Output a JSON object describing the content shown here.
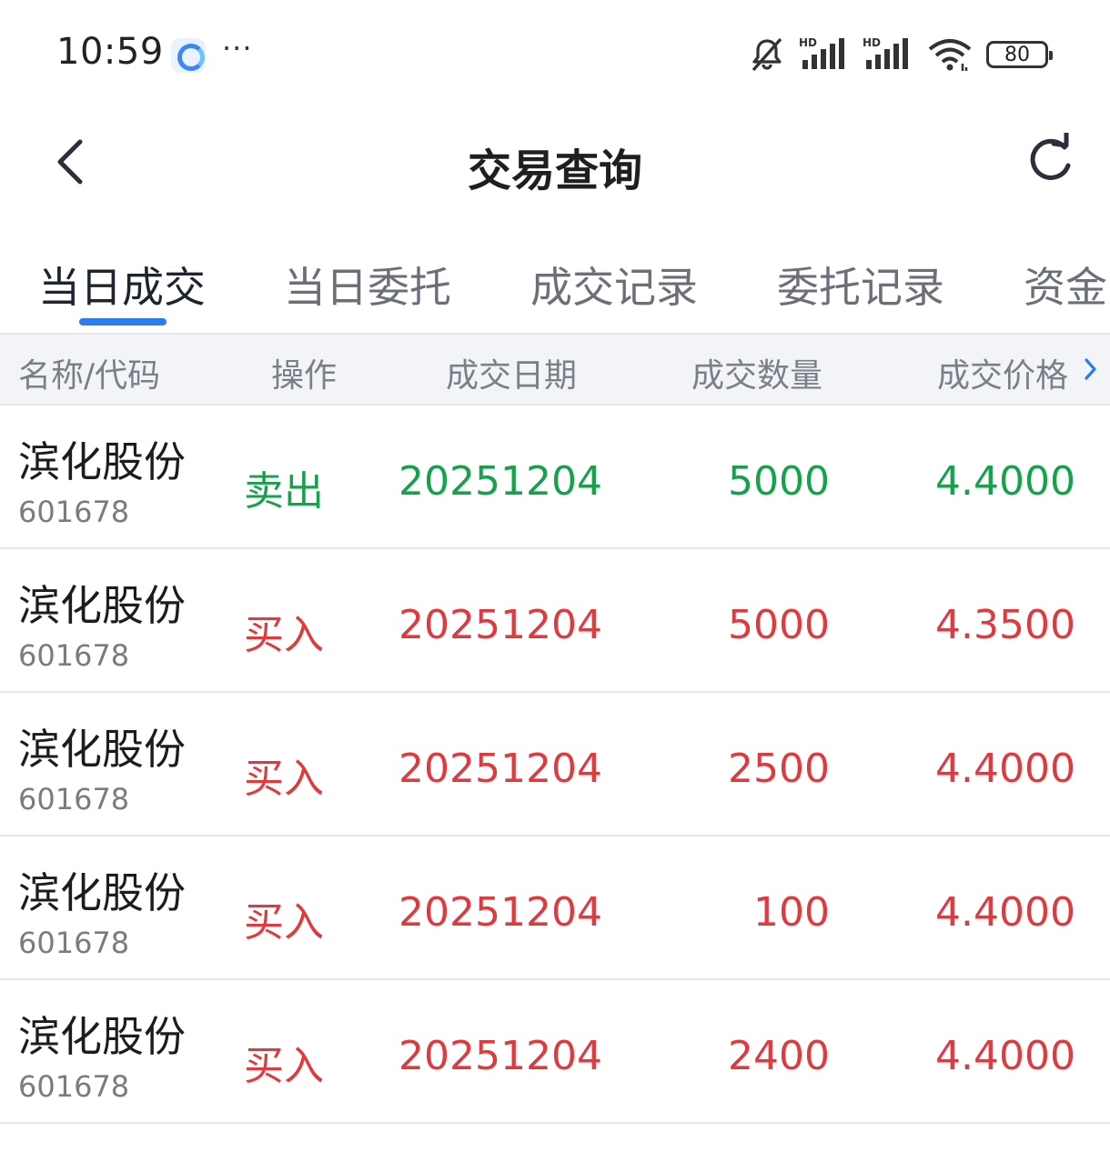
{
  "status_bar": {
    "time": "10:59",
    "more": "···",
    "battery": "80"
  },
  "header": {
    "title": "交易查询"
  },
  "tabs": [
    {
      "label": "当日成交"
    },
    {
      "label": "当日委托"
    },
    {
      "label": "成交记录"
    },
    {
      "label": "委托记录"
    },
    {
      "label": "资金"
    }
  ],
  "table": {
    "columns": [
      "名称/代码",
      "操作",
      "成交日期",
      "成交数量",
      "成交价格"
    ],
    "rows": [
      {
        "name": "滨化股份",
        "code": "601678",
        "op": "卖出",
        "date": "20251204",
        "qty": "5000",
        "price": "4.4000",
        "side": "sell"
      },
      {
        "name": "滨化股份",
        "code": "601678",
        "op": "买入",
        "date": "20251204",
        "qty": "5000",
        "price": "4.3500",
        "side": "buy"
      },
      {
        "name": "滨化股份",
        "code": "601678",
        "op": "买入",
        "date": "20251204",
        "qty": "2500",
        "price": "4.4000",
        "side": "buy"
      },
      {
        "name": "滨化股份",
        "code": "601678",
        "op": "买入",
        "date": "20251204",
        "qty": "100",
        "price": "4.4000",
        "side": "buy"
      },
      {
        "name": "滨化股份",
        "code": "601678",
        "op": "买入",
        "date": "20251204",
        "qty": "2400",
        "price": "4.4000",
        "side": "buy"
      }
    ]
  },
  "colors": {
    "sell": "#15a24a",
    "buy": "#e03a3e",
    "accent": "#2b7bf1"
  }
}
